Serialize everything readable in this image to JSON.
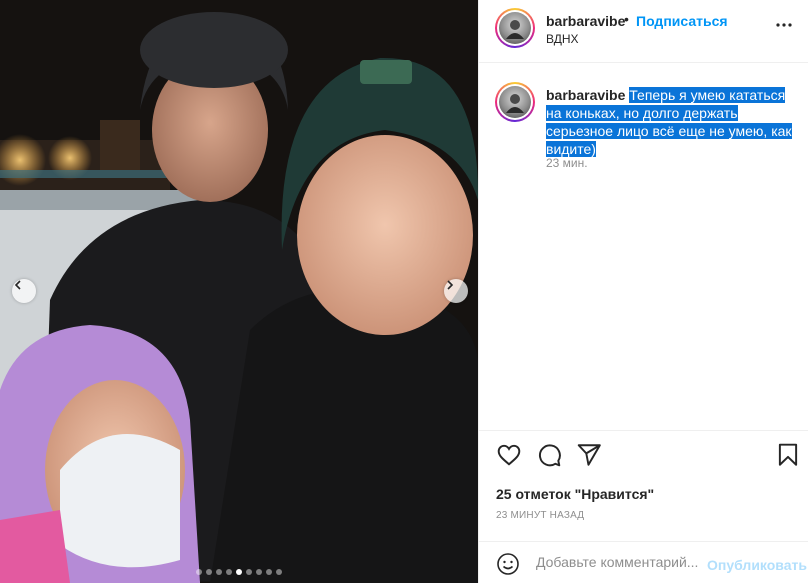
{
  "post": {
    "username": "barbaravibe",
    "separator": "•",
    "follow_label": "Подписаться",
    "location": "ВДНХ",
    "caption_text": "Теперь я умею кататься на коньках, но долго держать серьезное лицо всё еще не умею, как видите)",
    "caption_time": "23 мин.",
    "likes_label": "25 отметок \"Нравится\"",
    "post_time": "23 МИНУТ НАЗАД"
  },
  "carousel": {
    "slide_count": 9,
    "active_index": 4
  },
  "comment": {
    "placeholder": "Добавьте комментарий...",
    "publish_label": "Опубликовать"
  },
  "icons": {
    "more": "more-horizontal-icon",
    "like": "heart-icon",
    "comment": "comment-icon",
    "share": "paper-plane-icon",
    "save": "bookmark-icon",
    "emoji": "emoji-smile-icon",
    "prev": "chevron-left-icon",
    "next": "chevron-right-icon"
  },
  "colors": {
    "link_blue": "#0095f6",
    "publish_disabled": "#b2dffc",
    "selection": "#0a74d8",
    "muted": "#8e8e8e"
  }
}
